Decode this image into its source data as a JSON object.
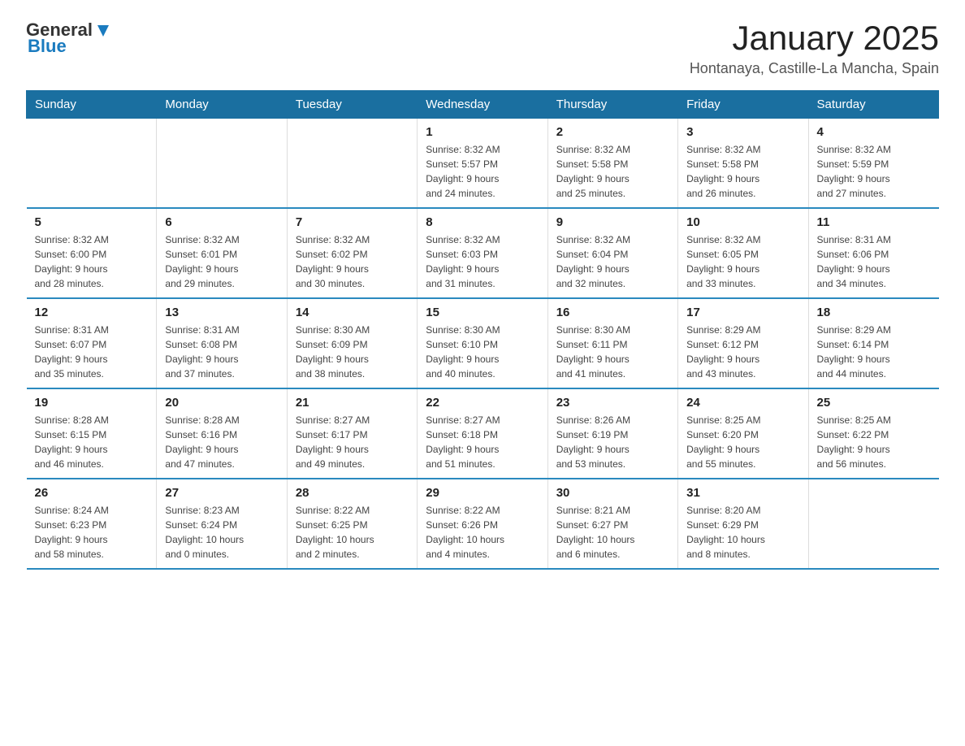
{
  "logo": {
    "text_general": "General",
    "text_blue": "Blue"
  },
  "header": {
    "month": "January 2025",
    "location": "Hontanaya, Castille-La Mancha, Spain"
  },
  "weekdays": [
    "Sunday",
    "Monday",
    "Tuesday",
    "Wednesday",
    "Thursday",
    "Friday",
    "Saturday"
  ],
  "weeks": [
    [
      {
        "day": "",
        "info": ""
      },
      {
        "day": "",
        "info": ""
      },
      {
        "day": "",
        "info": ""
      },
      {
        "day": "1",
        "info": "Sunrise: 8:32 AM\nSunset: 5:57 PM\nDaylight: 9 hours\nand 24 minutes."
      },
      {
        "day": "2",
        "info": "Sunrise: 8:32 AM\nSunset: 5:58 PM\nDaylight: 9 hours\nand 25 minutes."
      },
      {
        "day": "3",
        "info": "Sunrise: 8:32 AM\nSunset: 5:58 PM\nDaylight: 9 hours\nand 26 minutes."
      },
      {
        "day": "4",
        "info": "Sunrise: 8:32 AM\nSunset: 5:59 PM\nDaylight: 9 hours\nand 27 minutes."
      }
    ],
    [
      {
        "day": "5",
        "info": "Sunrise: 8:32 AM\nSunset: 6:00 PM\nDaylight: 9 hours\nand 28 minutes."
      },
      {
        "day": "6",
        "info": "Sunrise: 8:32 AM\nSunset: 6:01 PM\nDaylight: 9 hours\nand 29 minutes."
      },
      {
        "day": "7",
        "info": "Sunrise: 8:32 AM\nSunset: 6:02 PM\nDaylight: 9 hours\nand 30 minutes."
      },
      {
        "day": "8",
        "info": "Sunrise: 8:32 AM\nSunset: 6:03 PM\nDaylight: 9 hours\nand 31 minutes."
      },
      {
        "day": "9",
        "info": "Sunrise: 8:32 AM\nSunset: 6:04 PM\nDaylight: 9 hours\nand 32 minutes."
      },
      {
        "day": "10",
        "info": "Sunrise: 8:32 AM\nSunset: 6:05 PM\nDaylight: 9 hours\nand 33 minutes."
      },
      {
        "day": "11",
        "info": "Sunrise: 8:31 AM\nSunset: 6:06 PM\nDaylight: 9 hours\nand 34 minutes."
      }
    ],
    [
      {
        "day": "12",
        "info": "Sunrise: 8:31 AM\nSunset: 6:07 PM\nDaylight: 9 hours\nand 35 minutes."
      },
      {
        "day": "13",
        "info": "Sunrise: 8:31 AM\nSunset: 6:08 PM\nDaylight: 9 hours\nand 37 minutes."
      },
      {
        "day": "14",
        "info": "Sunrise: 8:30 AM\nSunset: 6:09 PM\nDaylight: 9 hours\nand 38 minutes."
      },
      {
        "day": "15",
        "info": "Sunrise: 8:30 AM\nSunset: 6:10 PM\nDaylight: 9 hours\nand 40 minutes."
      },
      {
        "day": "16",
        "info": "Sunrise: 8:30 AM\nSunset: 6:11 PM\nDaylight: 9 hours\nand 41 minutes."
      },
      {
        "day": "17",
        "info": "Sunrise: 8:29 AM\nSunset: 6:12 PM\nDaylight: 9 hours\nand 43 minutes."
      },
      {
        "day": "18",
        "info": "Sunrise: 8:29 AM\nSunset: 6:14 PM\nDaylight: 9 hours\nand 44 minutes."
      }
    ],
    [
      {
        "day": "19",
        "info": "Sunrise: 8:28 AM\nSunset: 6:15 PM\nDaylight: 9 hours\nand 46 minutes."
      },
      {
        "day": "20",
        "info": "Sunrise: 8:28 AM\nSunset: 6:16 PM\nDaylight: 9 hours\nand 47 minutes."
      },
      {
        "day": "21",
        "info": "Sunrise: 8:27 AM\nSunset: 6:17 PM\nDaylight: 9 hours\nand 49 minutes."
      },
      {
        "day": "22",
        "info": "Sunrise: 8:27 AM\nSunset: 6:18 PM\nDaylight: 9 hours\nand 51 minutes."
      },
      {
        "day": "23",
        "info": "Sunrise: 8:26 AM\nSunset: 6:19 PM\nDaylight: 9 hours\nand 53 minutes."
      },
      {
        "day": "24",
        "info": "Sunrise: 8:25 AM\nSunset: 6:20 PM\nDaylight: 9 hours\nand 55 minutes."
      },
      {
        "day": "25",
        "info": "Sunrise: 8:25 AM\nSunset: 6:22 PM\nDaylight: 9 hours\nand 56 minutes."
      }
    ],
    [
      {
        "day": "26",
        "info": "Sunrise: 8:24 AM\nSunset: 6:23 PM\nDaylight: 9 hours\nand 58 minutes."
      },
      {
        "day": "27",
        "info": "Sunrise: 8:23 AM\nSunset: 6:24 PM\nDaylight: 10 hours\nand 0 minutes."
      },
      {
        "day": "28",
        "info": "Sunrise: 8:22 AM\nSunset: 6:25 PM\nDaylight: 10 hours\nand 2 minutes."
      },
      {
        "day": "29",
        "info": "Sunrise: 8:22 AM\nSunset: 6:26 PM\nDaylight: 10 hours\nand 4 minutes."
      },
      {
        "day": "30",
        "info": "Sunrise: 8:21 AM\nSunset: 6:27 PM\nDaylight: 10 hours\nand 6 minutes."
      },
      {
        "day": "31",
        "info": "Sunrise: 8:20 AM\nSunset: 6:29 PM\nDaylight: 10 hours\nand 8 minutes."
      },
      {
        "day": "",
        "info": ""
      }
    ]
  ]
}
